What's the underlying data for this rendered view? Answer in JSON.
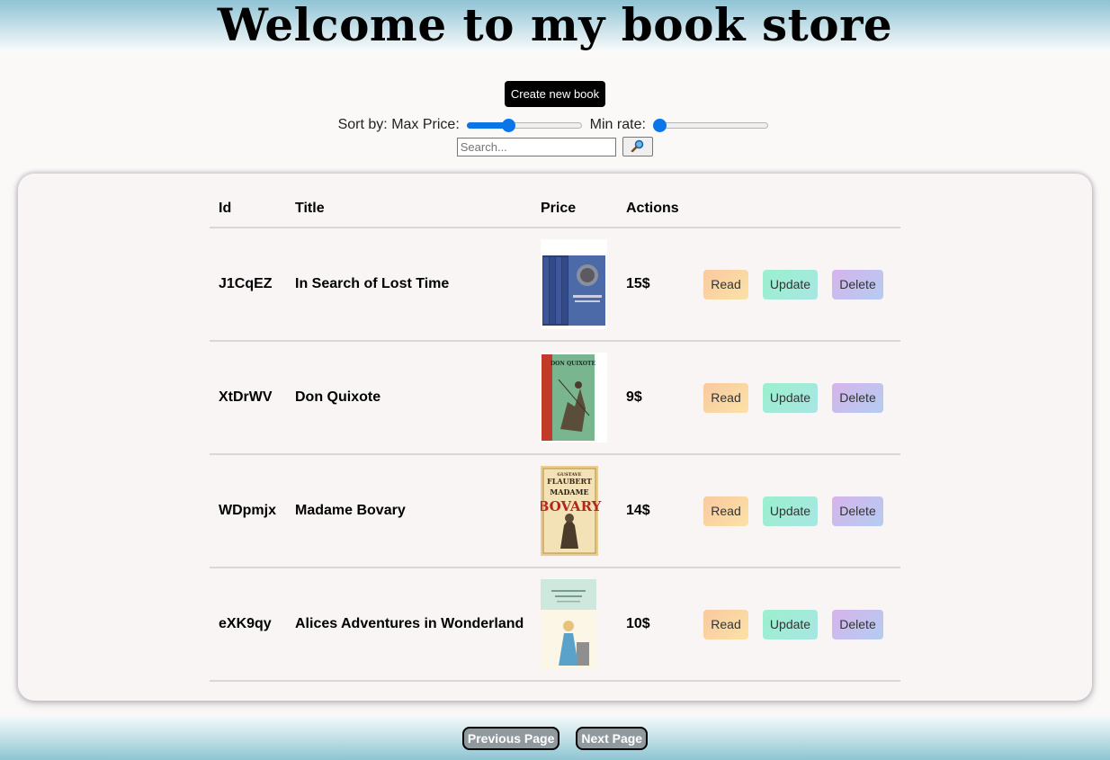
{
  "header": {
    "title": "Welcome to my book store"
  },
  "toolbar": {
    "create_label": "Create new book",
    "sort_label": "Sort by: Max Price:",
    "max_price_level": 0.36,
    "min_rate_label": "Min rate:",
    "min_rate_level": 0.0,
    "search_placeholder": "Search...",
    "search_icon": "magnifier-icon"
  },
  "table": {
    "headers": [
      "Id",
      "Title",
      "Price",
      "Actions"
    ],
    "rows": [
      {
        "id": "J1CqEZ",
        "title": "In Search of Lost Time",
        "price": "15$",
        "cover": "lost-time-cover"
      },
      {
        "id": "XtDrWV",
        "title": "Don Quixote",
        "price": "9$",
        "cover": "don-quixote-cover"
      },
      {
        "id": "WDpmjx",
        "title": "Madame Bovary",
        "price": "14$",
        "cover": "madame-bovary-cover"
      },
      {
        "id": "eXK9qy",
        "title": "Alices Adventures in Wonderland",
        "price": "10$",
        "cover": "alice-cover"
      }
    ],
    "actions": {
      "read": "Read",
      "update": "Update",
      "delete": "Delete"
    }
  },
  "footer": {
    "prev_label": "Previous Page",
    "next_label": "Next Page"
  },
  "cover_art": {
    "madame_bovary": {
      "author": "GUSTAVE",
      "author2": "FLAUBERT",
      "t1": "MADAME",
      "t2": "BOVARY"
    },
    "don_quixote": {
      "title": "DON QUIXOTE"
    }
  }
}
